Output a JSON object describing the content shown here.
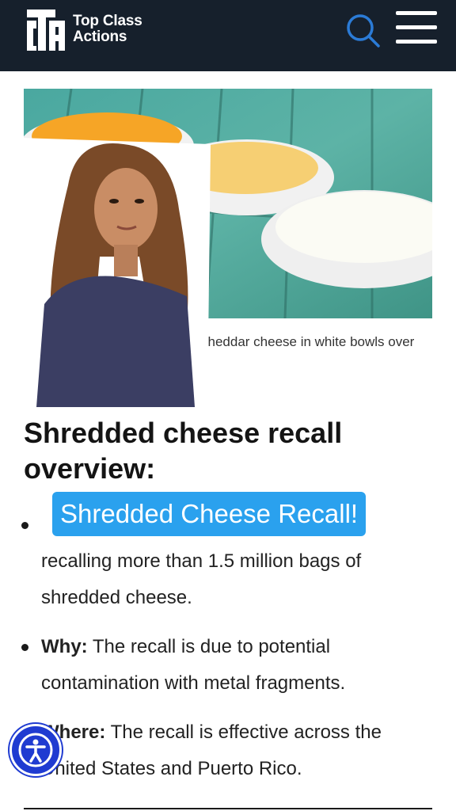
{
  "header": {
    "logo_text_line1": "Top Class",
    "logo_text_line2": "Actions",
    "logo_icon": "cta-logo-icon",
    "search_icon": "search-icon",
    "menu_icon": "hamburger-menu-icon"
  },
  "hero": {
    "caption": "cheddar cheese in white bowls over"
  },
  "article": {
    "heading": "Shredded cheese recall overview:",
    "bullets": [
      {
        "label": "",
        "text": "recalling more than 1.5 million bags of shredded cheese."
      },
      {
        "label": "Why:",
        "text": " The recall is due to potential contamination with metal fragments."
      },
      {
        "label": "Where:",
        "text": " The recall is effective across the United States and Puerto Rico."
      }
    ]
  },
  "overlay": {
    "banner_text": "Shredded Cheese Recall!"
  },
  "accessibility": {
    "icon": "accessibility-icon"
  },
  "colors": {
    "header_bg": "#16202c",
    "accent_blue": "#2aa1ee",
    "search_icon_color": "#2b7bd6",
    "a11y_bg": "#1f3bd1"
  }
}
